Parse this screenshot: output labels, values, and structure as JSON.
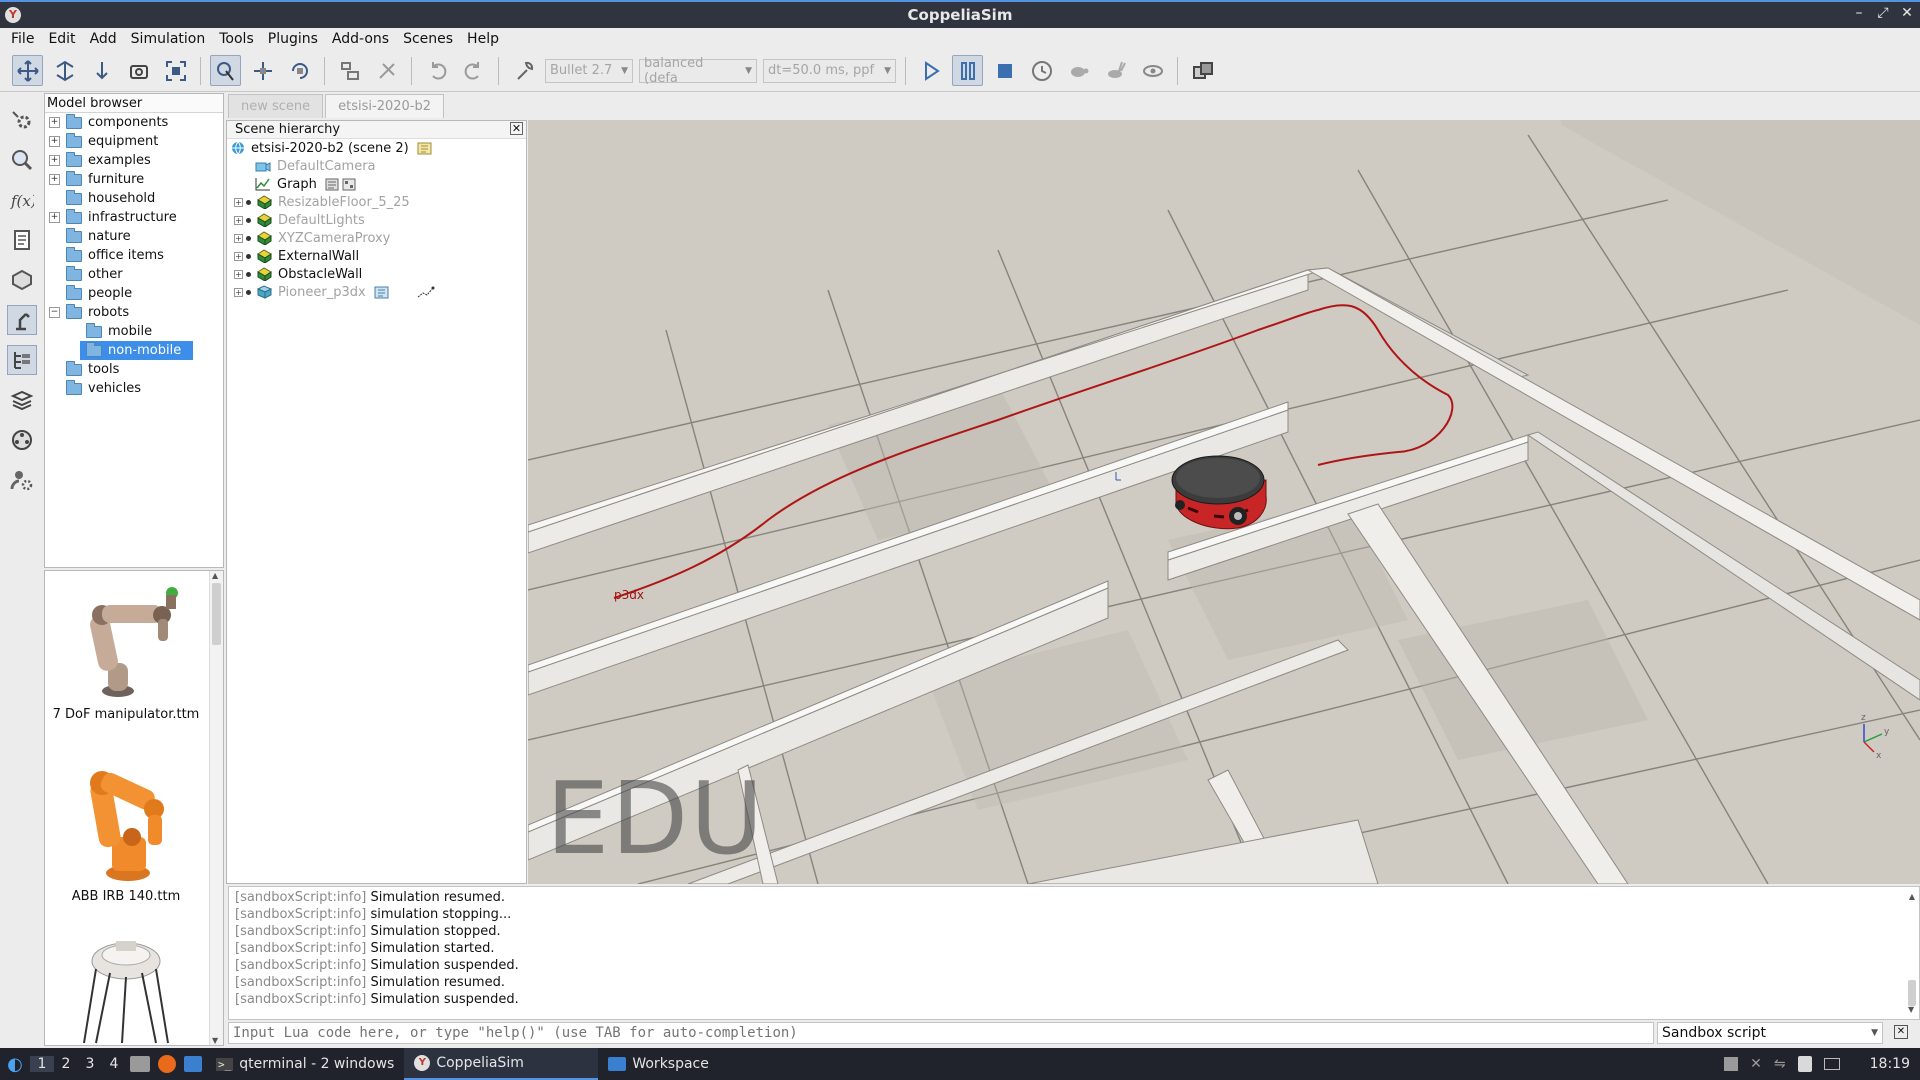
{
  "window": {
    "title": "CoppeliaSim",
    "minimize": "–",
    "maximize": "⤢",
    "close": "✕"
  },
  "menu": [
    "File",
    "Edit",
    "Add",
    "Simulation",
    "Tools",
    "Plugins",
    "Add-ons",
    "Scenes",
    "Help"
  ],
  "toolbar": {
    "engine": "Bullet 2.7",
    "accuracy": "balanced (defa",
    "timestep": "dt=50.0 ms, ppf"
  },
  "model_browser": {
    "title": "Model browser",
    "items": [
      {
        "label": "components",
        "expandable": true
      },
      {
        "label": "equipment",
        "expandable": true
      },
      {
        "label": "examples",
        "expandable": true
      },
      {
        "label": "furniture",
        "expandable": true
      },
      {
        "label": "household",
        "expandable": false
      },
      {
        "label": "infrastructure",
        "expandable": true
      },
      {
        "label": "nature",
        "expandable": false
      },
      {
        "label": "office items",
        "expandable": false
      },
      {
        "label": "other",
        "expandable": false
      },
      {
        "label": "people",
        "expandable": false
      },
      {
        "label": "robots",
        "expandable": true,
        "expanded": true
      },
      {
        "label": "mobile",
        "child": true
      },
      {
        "label": "non-mobile",
        "child": true,
        "selected": true
      },
      {
        "label": "tools",
        "expandable": false
      },
      {
        "label": "vehicles",
        "expandable": false
      }
    ],
    "thumbnails": [
      "7 DoF manipulator.ttm",
      "ABB IRB 140.ttm"
    ]
  },
  "tabs": [
    {
      "label": "new scene",
      "active": false
    },
    {
      "label": "etsisi-2020-b2",
      "active": true
    }
  ],
  "scene_hierarchy": {
    "title": "Scene hierarchy",
    "root": "etsisi-2020-b2 (scene 2)",
    "items": [
      {
        "label": "DefaultCamera",
        "dim": true,
        "icon": "camera-icon"
      },
      {
        "label": "Graph",
        "dim": false,
        "icon": "graph-icon"
      },
      {
        "label": "ResizableFloor_5_25",
        "dim": true,
        "icon": "shape-icon"
      },
      {
        "label": "DefaultLights",
        "dim": true,
        "icon": "shape-icon"
      },
      {
        "label": "XYZCameraProxy",
        "dim": true,
        "icon": "shape-icon"
      },
      {
        "label": "ExternalWall",
        "dim": false,
        "icon": "shape-icon"
      },
      {
        "label": "ObstacleWall",
        "dim": false,
        "icon": "shape-icon"
      },
      {
        "label": "Pioneer_p3dx",
        "dim": true,
        "icon": "model-icon"
      }
    ]
  },
  "viewport": {
    "watermark": "EDU",
    "path_label": "p3dx"
  },
  "console": {
    "lines": [
      {
        "prefix": "[sandboxScript:info]",
        "text": "Simulation resumed."
      },
      {
        "prefix": "[sandboxScript:info]",
        "text": "simulation stopping..."
      },
      {
        "prefix": "[sandboxScript:info]",
        "text": "Simulation stopped."
      },
      {
        "prefix": "[sandboxScript:info]",
        "text": "Simulation started."
      },
      {
        "prefix": "[sandboxScript:info]",
        "text": "Simulation suspended."
      },
      {
        "prefix": "[sandboxScript:info]",
        "text": "Simulation resumed."
      },
      {
        "prefix": "[sandboxScript:info]",
        "text": "Simulation suspended."
      }
    ],
    "input_placeholder": "Input Lua code here, or type \"help()\" (use TAB for auto-completion)",
    "script_select": "Sandbox script"
  },
  "taskbar": {
    "workspaces": [
      "1",
      "2",
      "3",
      "4"
    ],
    "tasks": [
      {
        "label": "qterminal - 2 windows",
        "active": false
      },
      {
        "label": "CoppeliaSim",
        "active": true
      },
      {
        "label": "Workspace",
        "active": false
      }
    ],
    "clock": "18:19"
  },
  "colors": {
    "accent": "#5294e2",
    "selection": "#3d8ee8",
    "path": "#b01515",
    "robot": "#c82626"
  }
}
